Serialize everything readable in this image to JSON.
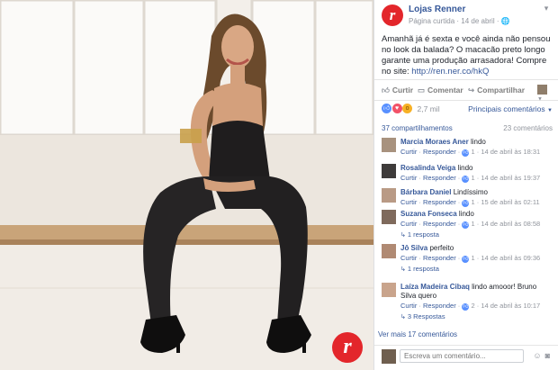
{
  "photo": {
    "badge_letter": "r"
  },
  "page": {
    "logo_letter": "r",
    "name": "Lojas Renner",
    "meta": "Página curtida · 14 de abril · 🌐",
    "menu_icon": "chevron-down-icon"
  },
  "post": {
    "text": "Amanhã já é sexta e você ainda não pensou no look da balada? O macacão preto longo garante uma produção arrasadora! Compre no site:",
    "link": "http://ren.ner.co/hkQ"
  },
  "actions": {
    "like": "Curtir",
    "comment": "Comentar",
    "share": "Compartilhar"
  },
  "reactions": {
    "count": "2,7 mil",
    "top_comments": "Principais comentários"
  },
  "stats": {
    "shares": "37 compartilhamentos",
    "comments": "23 comentários"
  },
  "comments": [
    {
      "author": "Marcia Moraes Aner",
      "text": "lindo",
      "like": "Curtir",
      "reply": "Responder",
      "likes": "1",
      "time": "14 de abril às 18:31",
      "replies": ""
    },
    {
      "author": "Rosalinda Veiga",
      "text": "lindo",
      "like": "Curtir",
      "reply": "Responder",
      "likes": "1",
      "time": "14 de abril às 19:37",
      "replies": ""
    },
    {
      "author": "Bárbara Daniel",
      "text": "Lindíssimo",
      "like": "Curtir",
      "reply": "Responder",
      "likes": "1",
      "time": "15 de abril às 02:11",
      "replies": ""
    },
    {
      "author": "Suzana Fonseca",
      "text": "lindo",
      "like": "Curtir",
      "reply": "Responder",
      "likes": "1",
      "time": "14 de abril às 08:58",
      "replies": "1 resposta"
    },
    {
      "author": "Jô Silva",
      "text": "perfeito",
      "like": "Curtir",
      "reply": "Responder",
      "likes": "1",
      "time": "14 de abril às 09:36",
      "replies": "1 resposta"
    },
    {
      "author": "Laíza Madeira Cibaq",
      "text": "lindo amooor! Bruno Silva quero",
      "like": "Curtir",
      "reply": "Responder",
      "likes": "2",
      "time": "14 de abril às 10:17",
      "replies": "3 Respostas"
    }
  ],
  "more_comments": "Ver mais 17 comentários",
  "composer": {
    "placeholder": "Escreva um comentário..."
  }
}
